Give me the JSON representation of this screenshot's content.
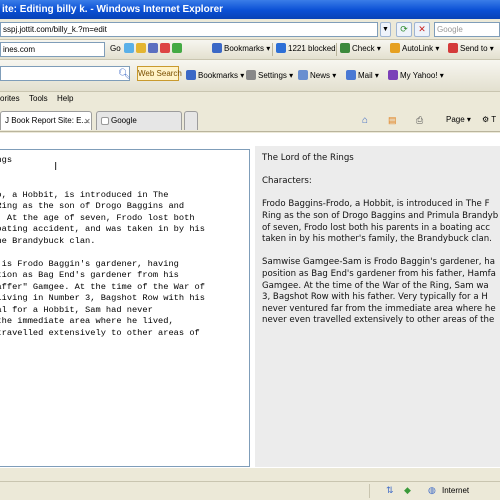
{
  "window": {
    "title": "ite: Editing billy k. - Windows Internet Explorer"
  },
  "address": {
    "url": "sspj.jottit.com/billy_k.?m=edit",
    "search_placeholder": "Google"
  },
  "links_bar": {
    "domain": "ines.com",
    "go_label": "Go",
    "bookmarks_label": "Bookmarks",
    "blocked_label": "1221 blocked",
    "check_label": "Check",
    "autolink_label": "AutoLink",
    "sendto_label": "Send to"
  },
  "google_bar": {
    "search_label": "Web Search",
    "bookmarks_label": "Bookmarks",
    "settings_label": "Settings",
    "news_label": "News",
    "mail_label": "Mail",
    "myyahoo_label": "My Yahoo!"
  },
  "menu": {
    "items": [
      "orites",
      "Tools",
      "Help"
    ]
  },
  "tabs": [
    {
      "label": "J Book Report Site: E..."
    },
    {
      "label": "Google"
    }
  ],
  "command_bar": {
    "page_label": "Page"
  },
  "editor": {
    "text": "Rings\n\n\nodo, a Hobbit, is introduced in The\ne Ring as the son of Drogo Baggins and\nck. At the age of seven, Frodo lost both\n boating accident, and was taken in by his\n the Brandybuck clan.\n\nam is Frodo Baggin's gardener, having\nsition as Bag End's gardener from his\n\"Gaffer\" Gamgee. At the time of the War of\ns living in Number 3, Bagshot Row with his\nical for a Hobbit, Sam had never\nm the immediate area where he lived,\nn travelled extensively to other areas of"
  },
  "preview": {
    "text": "The Lord of the Rings\n\nCharacters:\n\nFrodo Baggins-Frodo, a Hobbit, is introduced in The F\nRing as the son of Drogo Baggins and Primula Brandyb\nof seven, Frodo lost both his parents in a boating acc\ntaken in by his mother's family, the Brandybuck clan.\n\nSamwise Gamgee-Sam is Frodo Baggin's gardener, ha\nposition as Bag End's gardener from his father, Hamfa\nGamgee. At the time of the War of the Ring, Sam wa\n3, Bagshot Row with his father. Very typically for a H\nnever ventured far from the immediate area where he\nnever even travelled extensively to other areas of the"
  },
  "status": {
    "zone_label": "Internet"
  },
  "colors": {
    "titlebar": "#0a4fd4",
    "editor_bg": "#ffffff",
    "preview_bg": "#ececec"
  }
}
